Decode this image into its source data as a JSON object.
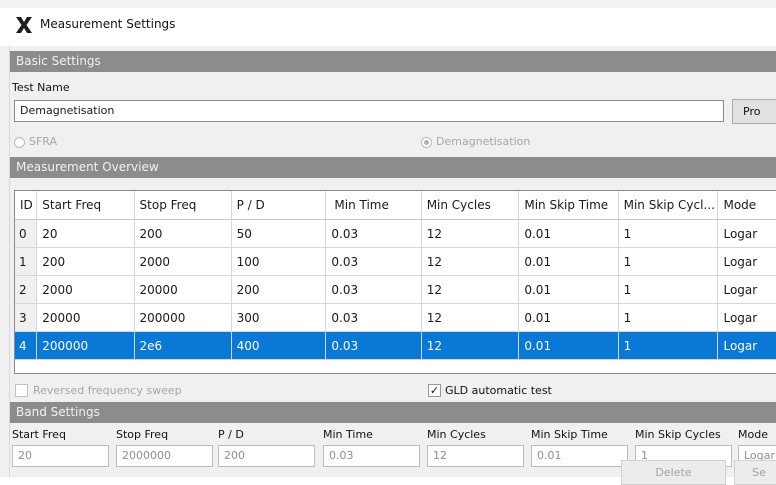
{
  "window": {
    "title": "Measurement Settings",
    "icon": "x-logo-icon"
  },
  "basic": {
    "header": "Basic Settings",
    "test_name_label": "Test Name",
    "test_name_value": "Demagnetisation",
    "pro_button": "Pro",
    "radio_sfra": "SFRA",
    "radio_demag": "Demagnetisation",
    "selected_mode": "Demagnetisation"
  },
  "overview": {
    "header": "Measurement Overview",
    "columns": [
      "ID",
      "Start Freq",
      "Stop Freq",
      "P / D",
      "Min Time",
      "Min Cycles",
      "Min Skip Time",
      "Min Skip Cycl...",
      "Mode"
    ],
    "rows": [
      [
        "0",
        "20",
        "200",
        "50",
        "0.03",
        "12",
        "0.01",
        "1",
        "Logar"
      ],
      [
        "1",
        "200",
        "2000",
        "100",
        "0.03",
        "12",
        "0.01",
        "1",
        "Logar"
      ],
      [
        "2",
        "2000",
        "20000",
        "200",
        "0.03",
        "12",
        "0.01",
        "1",
        "Logar"
      ],
      [
        "3",
        "20000",
        "200000",
        "300",
        "0.03",
        "12",
        "0.01",
        "1",
        "Logar"
      ],
      [
        "4",
        "200000",
        "2e6",
        "400",
        "0.03",
        "12",
        "0.01",
        "1",
        "Logar"
      ]
    ],
    "selected_row": 4,
    "reversed_label": "Reversed frequency sweep",
    "reversed_checked": false,
    "gld_label": "GLD automatic test",
    "gld_checked": true
  },
  "band": {
    "header": "Band Settings",
    "labels": [
      "Start Freq",
      "Stop Freq",
      "P / D",
      "Min Time",
      "Min Cycles",
      "Min Skip Time",
      "Min Skip Cycles",
      "Mode"
    ],
    "values": [
      "20",
      "2000000",
      "200",
      "0.03",
      "12",
      "0.01",
      "1",
      "Logar"
    ],
    "delete_button": "Delete",
    "set_button": "Se"
  },
  "colors": {
    "section_header": "#8c8c8c",
    "selection": "#0a78d7"
  }
}
